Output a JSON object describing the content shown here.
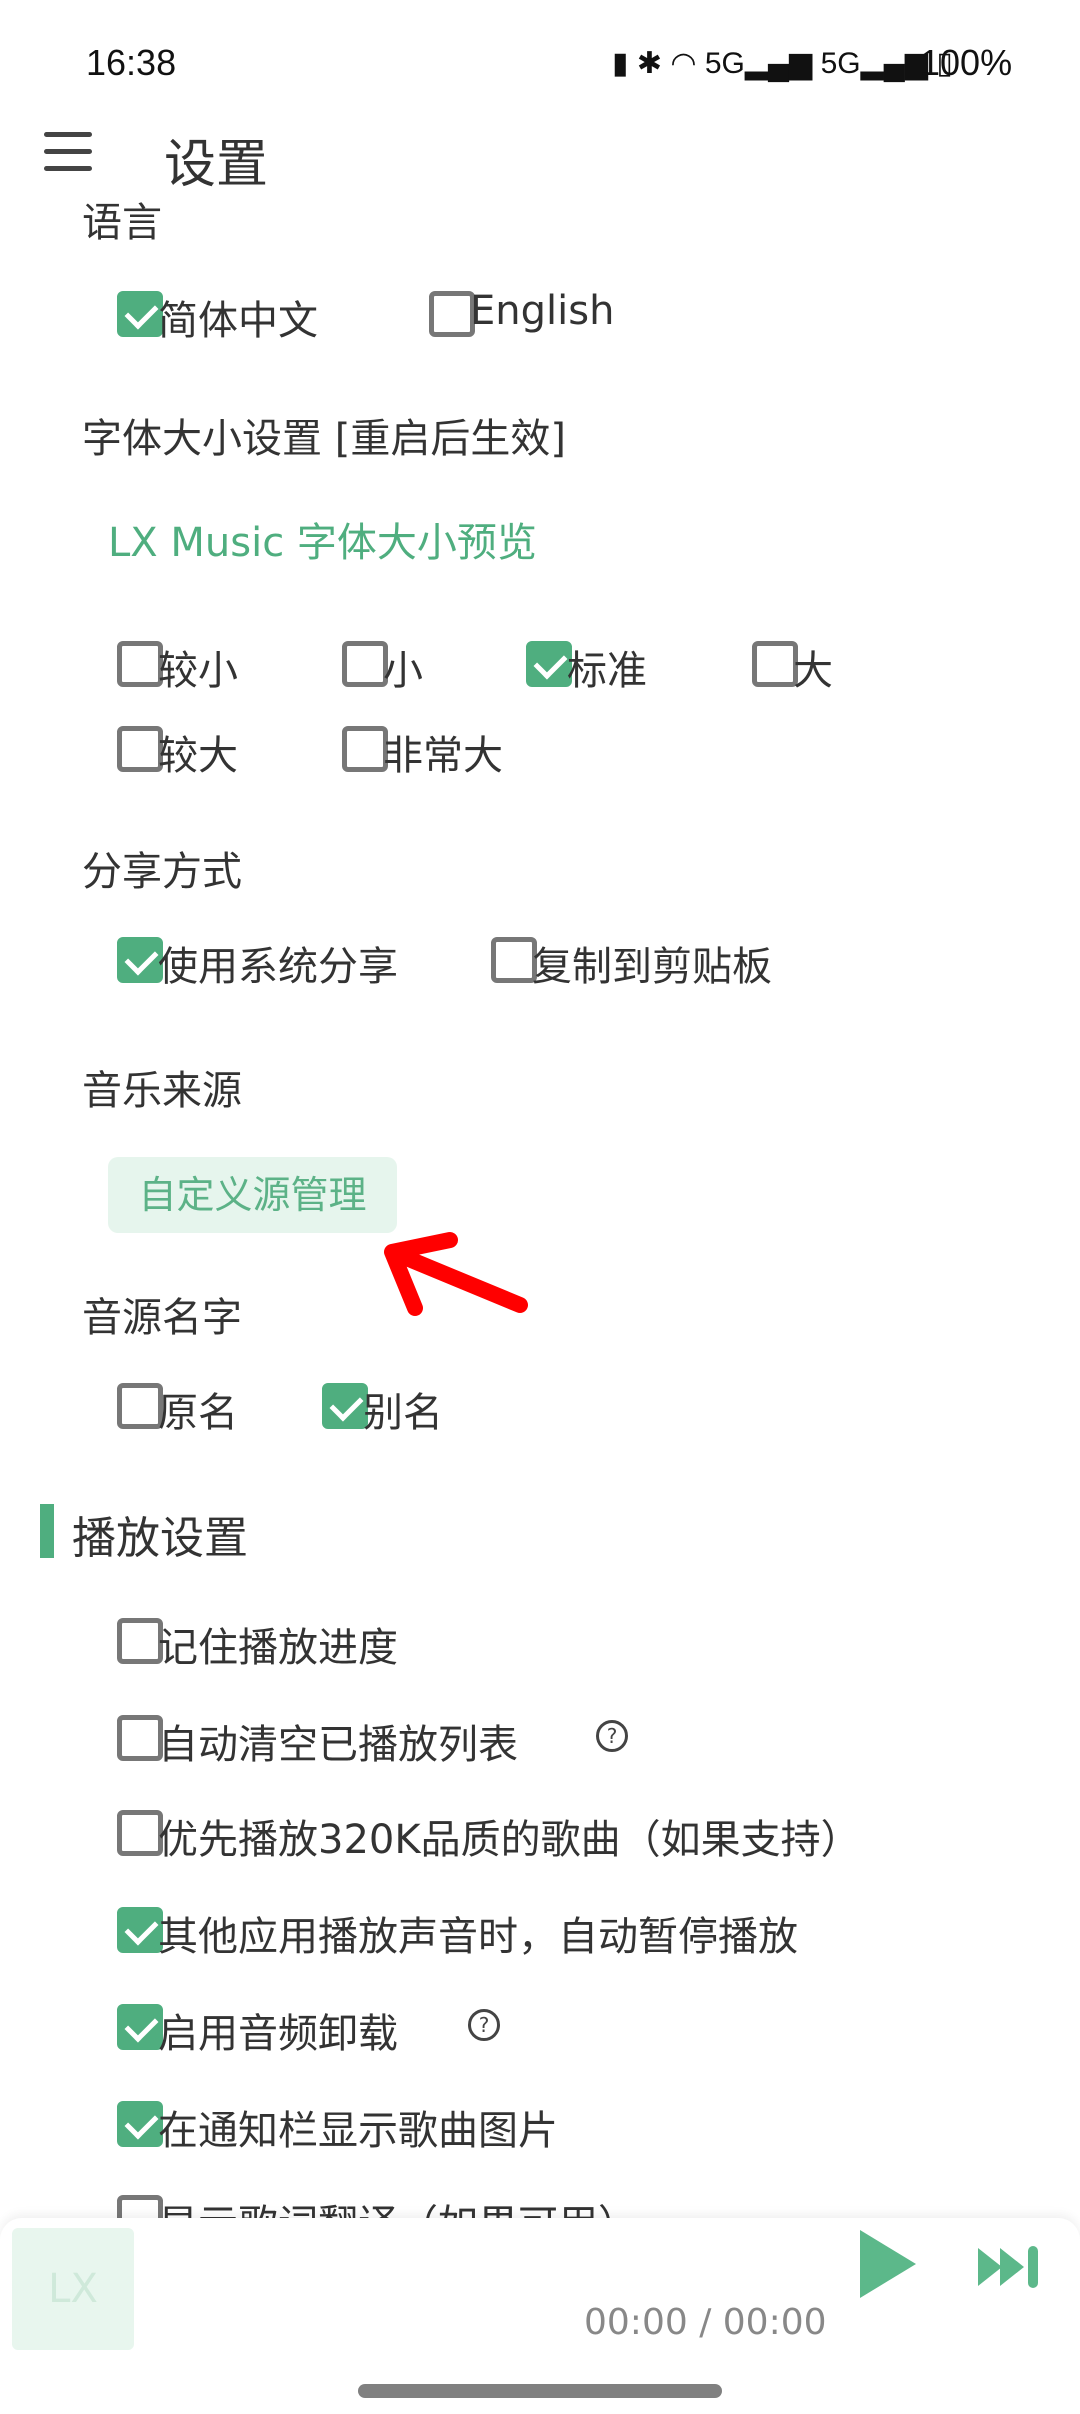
{
  "status_bar": {
    "time": "16:38",
    "battery": "100%",
    "icons": [
      "vibrate-icon",
      "bluetooth-icon",
      "wifi-icon",
      "5g-signal-icon",
      "5g-signal-icon",
      "battery-icon"
    ]
  },
  "header": {
    "title": "设置",
    "menu_icon": "hamburger-icon"
  },
  "language": {
    "label": "语言",
    "options": [
      {
        "label": "简体中文",
        "checked": true
      },
      {
        "label": "English",
        "checked": false
      }
    ]
  },
  "font_size": {
    "label": "字体大小设置 [重启后生效]",
    "preview": "LX Music 字体大小预览",
    "options": [
      {
        "label": "较小",
        "checked": false
      },
      {
        "label": "小",
        "checked": false
      },
      {
        "label": "标准",
        "checked": true
      },
      {
        "label": "大",
        "checked": false
      },
      {
        "label": "较大",
        "checked": false
      },
      {
        "label": "非常大",
        "checked": false
      }
    ]
  },
  "share": {
    "label": "分享方式",
    "options": [
      {
        "label": "使用系统分享",
        "checked": true
      },
      {
        "label": "复制到剪贴板",
        "checked": false
      }
    ]
  },
  "music_source": {
    "label": "音乐来源",
    "button": "自定义源管理"
  },
  "source_name": {
    "label": "音源名字",
    "options": [
      {
        "label": "原名",
        "checked": false
      },
      {
        "label": "别名",
        "checked": true
      }
    ]
  },
  "play_settings": {
    "title": "播放设置",
    "items": [
      {
        "label": "记住播放进度",
        "checked": false,
        "help": false
      },
      {
        "label": "自动清空已播放列表",
        "checked": false,
        "help": true
      },
      {
        "label": "优先播放320K品质的歌曲（如果支持）",
        "checked": false,
        "help": false
      },
      {
        "label": "其他应用播放声音时，自动暂停播放",
        "checked": true,
        "help": false
      },
      {
        "label": "启用音频卸载",
        "checked": true,
        "help": true
      },
      {
        "label": "在通知栏显示歌曲图片",
        "checked": true,
        "help": false
      },
      {
        "label": "显示歌词翻译（如果可用）",
        "checked": false,
        "help": false
      }
    ]
  },
  "player": {
    "thumb": "LX",
    "time": "00:00 / 00:00"
  },
  "colors": {
    "accent": "#4fae7f",
    "annotation": "#ff0000"
  }
}
